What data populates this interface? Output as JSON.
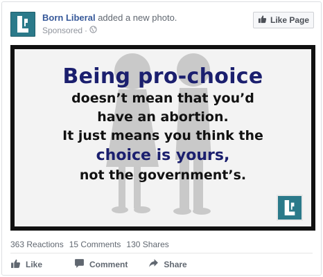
{
  "post": {
    "page_name": "Born Liberal",
    "action_text": "added a new photo.",
    "sponsored": "Sponsored",
    "meta_separator": "·",
    "like_page_label": "Like Page"
  },
  "image": {
    "line1": "Being pro-choice",
    "line2": "doesn’t mean that you’d",
    "line3": "have an abortion.",
    "line4": "It just means you think the",
    "line5": "choice is yours,",
    "line6": "not the government’s."
  },
  "stats": {
    "reactions": "363 Reactions",
    "comments": "15 Comments",
    "shares": "130 Shares"
  },
  "actions": {
    "like": "Like",
    "comment": "Comment",
    "share": "Share"
  },
  "colors": {
    "brand_teal": "#2b7a8a",
    "link_blue": "#365899",
    "quote_navy": "#1b1f6e"
  },
  "icons": {
    "logo": "born-liberal-logo-icon",
    "globe": "globe-icon",
    "thumbs_up": "thumbs-up-icon",
    "comment": "comment-bubble-icon",
    "share": "share-arrow-icon"
  }
}
